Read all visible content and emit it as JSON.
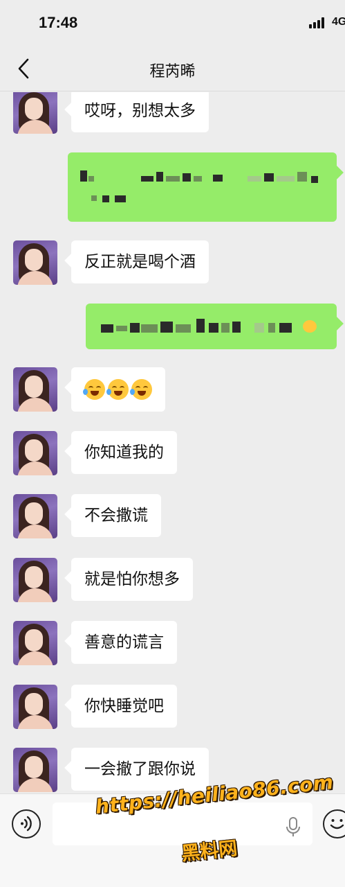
{
  "status_bar": {
    "time": "17:48",
    "network": "4G"
  },
  "nav": {
    "title": "程芮晞"
  },
  "messages": [
    {
      "from": "contact",
      "text": "哎呀，别想太多"
    },
    {
      "from": "me",
      "text": "",
      "redacted": true
    },
    {
      "from": "contact",
      "text": "反正就是喝个酒"
    },
    {
      "from": "me",
      "text": "",
      "redacted": true
    },
    {
      "from": "contact",
      "text": "",
      "emoji": [
        "face-with-tears-of-joy",
        "face-with-tears-of-joy",
        "face-with-tears-of-joy"
      ]
    },
    {
      "from": "contact",
      "text": "你知道我的"
    },
    {
      "from": "contact",
      "text": "不会撒谎"
    },
    {
      "from": "contact",
      "text": "就是怕你想多"
    },
    {
      "from": "contact",
      "text": "善意的谎言"
    },
    {
      "from": "contact",
      "text": "你快睡觉吧"
    },
    {
      "from": "contact",
      "text": "一会撤了跟你说"
    }
  ],
  "input_bar": {
    "placeholder": ""
  },
  "watermark": {
    "url": "https://heiliao86.com",
    "name": "黑料网"
  },
  "colors": {
    "background": "#ededed",
    "my_bubble": "#95ec69",
    "their_bubble": "#ffffff",
    "watermark": "#ffb21c"
  },
  "icons": [
    "back-chevron-icon",
    "voice-icon",
    "mic-icon",
    "emoji-icon"
  ]
}
